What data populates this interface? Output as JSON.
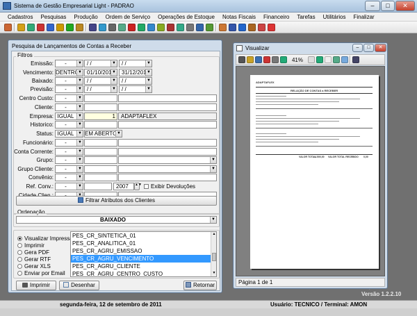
{
  "window": {
    "title": "Sistema de Gestão Empresarial Light - PADRAO"
  },
  "menu": [
    "Cadastros",
    "Pesquisas",
    "Produção",
    "Ordem de Serviço",
    "Operações de Estoque",
    "Notas Fiscais",
    "Financeiro",
    "Tarefas",
    "Utilitários",
    "Finalizar"
  ],
  "toolbar_icons": [
    "cadastro-icon",
    "cliente-icon",
    "fornecedor-icon",
    "produto-icon",
    "nota-icon",
    "edit-icon",
    "check-icon",
    "box-icon",
    "pen-icon",
    "search-doc-icon",
    "report-icon",
    "doc-icon",
    "pdf-icon",
    "sheet-icon",
    "doc2-icon",
    "money-icon",
    "bank-icon",
    "card-icon",
    "calc-icon",
    "mail-icon",
    "list-icon",
    "chart-icon",
    "network-icon",
    "info-icon",
    "user-icon",
    "users-icon",
    "exit-icon"
  ],
  "toolbar_colors": [
    "#c63",
    "#d4a017",
    "#3a7",
    "#c33",
    "#36c",
    "#c90",
    "#2a2",
    "#b82",
    "#448",
    "#39c",
    "#666",
    "#5a8",
    "#c22",
    "#2a6",
    "#38c",
    "#8a2",
    "#a33",
    "#3a8",
    "#777",
    "#36a",
    "#593",
    "#c73",
    "#35a",
    "#26c",
    "#a62",
    "#c44",
    "#d33"
  ],
  "dialog": {
    "title": "Pesquisa de Lançamentos de Contas a Receber",
    "filters_label": "Filtros",
    "fields": [
      {
        "label": "Emissão:",
        "op": "-",
        "from": " / /",
        "to": " / /"
      },
      {
        "label": "Vencimento:",
        "op": "DENTRO",
        "from": "01/10/2011",
        "to": "31/12/2011"
      },
      {
        "label": "Baixado:",
        "op": "-",
        "from": " / /",
        "to": " / /"
      },
      {
        "label": "Previsão:",
        "op": "-",
        "from": " / /",
        "to": " / /"
      },
      {
        "label": "Centro Custo:",
        "op": "-"
      },
      {
        "label": "Cliente:",
        "op": "-"
      },
      {
        "label": "Empresa:",
        "op": "IGUAL",
        "code": "1",
        "desc": "ADAPTAFLEX"
      },
      {
        "label": "Historico:",
        "op": "-"
      },
      {
        "label": "Status:",
        "op": "IGUAL",
        "value": "EM ABERTO"
      },
      {
        "label": "Funcionário:",
        "op": "-"
      },
      {
        "label": "Conta Corrente:",
        "op": "-"
      },
      {
        "label": "Grupo:",
        "op": "-"
      },
      {
        "label": "Grupo Cliente:",
        "op": "-"
      },
      {
        "label": "Convênio:",
        "op": "-"
      },
      {
        "label": "Ref. Conv.:",
        "op": "-",
        "year": "2007",
        "checkbox": "Exibir Devoluções"
      },
      {
        "label": "Cidade Clien.:",
        "op": "-"
      }
    ],
    "filter_button": "Filtrar Atributos dos Clientes",
    "ordering_label": "Ordenação",
    "ordering_value": "BAIXADO",
    "output_options": [
      "Visualizar Impressão",
      "Imprimir",
      "Gera PDF",
      "Gerar RTF",
      "Gerar XLS",
      "Enviar por Email"
    ],
    "output_selected": 0,
    "reports": [
      "PES_CR_SINTETICA_01",
      "PES_CR_ANALITICA_01",
      "PES_CR_AGRU_EMISSAO",
      "PES_CR_AGRU_VENCIMENTO",
      "PES_CR_AGRU_CLIENTE",
      "PES_CR_AGRU_CENTRO_CUSTO"
    ],
    "report_selected": 3,
    "buttons": {
      "print": "Imprimir",
      "design": "Desenhar",
      "back": "Retornar"
    }
  },
  "viewer": {
    "title": "Visualizar",
    "zoom": "41%",
    "page_status": "Página 1 de 1",
    "report": {
      "company": "ADAPTAFLEX",
      "heading": "RELAÇÃO DE CONTAS a RECEBER",
      "total_label": "VALOR TOTAL",
      "total_value": "4.500,00",
      "total_received_label": "VALOR TOTAL RECEBIDO",
      "total_received_value": "0,00"
    }
  },
  "status": {
    "date": "segunda-feira, 12 de setembro de 2011",
    "user": "Usuário: TECNICO / Terminal: AMON"
  },
  "version": "Versão 1.2.2.10"
}
